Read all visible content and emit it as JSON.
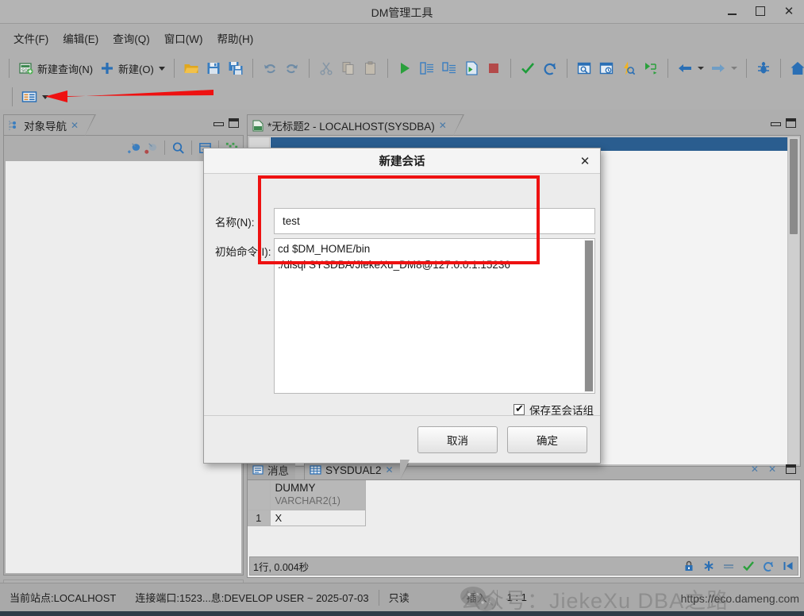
{
  "window": {
    "title": "DM管理工具",
    "minimize": "−",
    "maximize": "□",
    "close": "✕"
  },
  "menubar": {
    "items": [
      {
        "name": "file",
        "label": "文件(F)"
      },
      {
        "name": "edit",
        "label": "编辑(E)"
      },
      {
        "name": "query",
        "label": "查询(Q)"
      },
      {
        "name": "window",
        "label": "窗口(W)"
      },
      {
        "name": "help",
        "label": "帮助(H)"
      }
    ]
  },
  "toolbar": {
    "new_query_label": "新建查询(N)",
    "new_label": "新建(O)",
    "items": [
      {
        "name": "new-query-button",
        "icon": "sql-new-icon",
        "label": "新建查询(N)"
      },
      {
        "name": "new-button",
        "icon": "plus-icon",
        "label": "新建(O)"
      },
      {
        "name": "open-file-button",
        "icon": "folder-open-icon",
        "label": ""
      },
      {
        "name": "save-button",
        "icon": "save-icon",
        "label": ""
      },
      {
        "name": "save-all-button",
        "icon": "save-all-icon",
        "label": ""
      },
      {
        "name": "undo-button",
        "icon": "undo-icon",
        "label": ""
      },
      {
        "name": "redo-button",
        "icon": "redo-icon",
        "label": ""
      },
      {
        "name": "cut-button",
        "icon": "scissors-icon",
        "label": ""
      },
      {
        "name": "copy-button",
        "icon": "copy-icon",
        "label": ""
      },
      {
        "name": "paste-button",
        "icon": "paste-icon",
        "label": ""
      },
      {
        "name": "execute-button",
        "icon": "play-icon",
        "label": ""
      },
      {
        "name": "execute-script-button",
        "icon": "script-run-icon",
        "label": ""
      },
      {
        "name": "execute-step-button",
        "icon": "script-step-icon",
        "label": ""
      },
      {
        "name": "execute-to-file-button",
        "icon": "export-run-icon",
        "label": ""
      },
      {
        "name": "stop-button",
        "icon": "stop-icon",
        "label": ""
      },
      {
        "name": "commit-button",
        "icon": "check-icon",
        "label": ""
      },
      {
        "name": "rollback-button",
        "icon": "rollback-icon",
        "label": ""
      },
      {
        "name": "explain-plan-button",
        "icon": "plan-search-icon",
        "label": ""
      },
      {
        "name": "plan-history-button",
        "icon": "plan-clock-icon",
        "label": ""
      },
      {
        "name": "fast-search-button",
        "icon": "lightning-search-icon",
        "label": ""
      },
      {
        "name": "flow-button",
        "icon": "flow-branch-icon",
        "label": ""
      },
      {
        "name": "back-button",
        "icon": "arrow-left-icon",
        "label": ""
      },
      {
        "name": "forward-button",
        "icon": "arrow-right-icon",
        "label": ""
      },
      {
        "name": "debug-button",
        "icon": "bug-icon",
        "label": ""
      },
      {
        "name": "home-button",
        "icon": "home-icon",
        "label": ""
      }
    ]
  },
  "toolbar2": {
    "session_button_name": "session-list-button",
    "session_icon": "session-grid-icon"
  },
  "left_panel": {
    "tab_label": "对象导航",
    "tab_icon": "object-nav-icon",
    "close_icon": "✕",
    "minimize_icon": "minimize-icon",
    "maximize_icon": "maximize-icon",
    "toolbar_icons": [
      {
        "name": "add-connection-icon"
      },
      {
        "name": "remove-connection-icon"
      },
      {
        "name": "search-icon"
      },
      {
        "name": "collapse-all-icon"
      },
      {
        "name": "refresh-tree-icon"
      }
    ]
  },
  "editor_panel": {
    "tab_label": "*无标题2 - LOCALHOST(SYSDBA)",
    "tab_icon": "sql-file-icon",
    "close_icon": "✕",
    "minimize_icon": "minimize-icon",
    "maximize_icon": "maximize-icon"
  },
  "results_panel": {
    "tabs": [
      {
        "name": "tab-messages",
        "label": "消息",
        "icon": "message-icon",
        "active": false
      },
      {
        "name": "tab-sysdual2",
        "label": "SYSDUAL2",
        "icon": "table-grid-icon",
        "active": true
      }
    ],
    "close_icon": "✕",
    "detach_icon": "detach-icon",
    "maximize_icon": "maximize-icon",
    "grid": {
      "row_header": "",
      "columns": [
        {
          "name": "DUMMY",
          "type": "VARCHAR2(1)"
        }
      ],
      "rows": [
        {
          "index": "1",
          "values": [
            "X"
          ]
        }
      ]
    },
    "status_text": "1行, 0.004秒",
    "status_icons": [
      {
        "name": "lock-icon"
      },
      {
        "name": "add-row-icon"
      },
      {
        "name": "delete-row-icon"
      },
      {
        "name": "commit-check-icon"
      },
      {
        "name": "undo-row-icon"
      },
      {
        "name": "first-page-icon"
      }
    ]
  },
  "statusbar": {
    "site": "当前站点:LOCALHOST",
    "port_info": "连接端口:1523...息:DEVELOP USER ~ 2025-07-03",
    "readonly": "只读",
    "insert_mode": "插入",
    "cursor": "1 : 1"
  },
  "dialog": {
    "title": "新建会话",
    "close_label": "✕",
    "name_label": "名称(N):",
    "name_value": "test",
    "name_placeholder": "",
    "command_label": "初始命令(I):",
    "command_value": "cd $DM_HOME/bin\n./disql SYSDBA/JiekeXu_DM8@127.0.0.1:15236",
    "checkbox_label": "保存至会话组",
    "checkbox_checked": true,
    "cancel_label": "取消",
    "confirm_label": "确定"
  },
  "annotations": {
    "arrow_color": "#ee1111",
    "rect_color": "#ee1111"
  },
  "watermark": {
    "text": "公众号：JiekeXu DBA之路",
    "url": "https://eco.dameng.com"
  },
  "colors": {
    "window_bg": "#b0b0b0",
    "panel_bg": "#aeaeae",
    "editor_bg": "#f3f3f3",
    "dialog_bg": "#ececec",
    "accent_blue": "#2a5d8f",
    "annotation_red": "#ee1111"
  }
}
